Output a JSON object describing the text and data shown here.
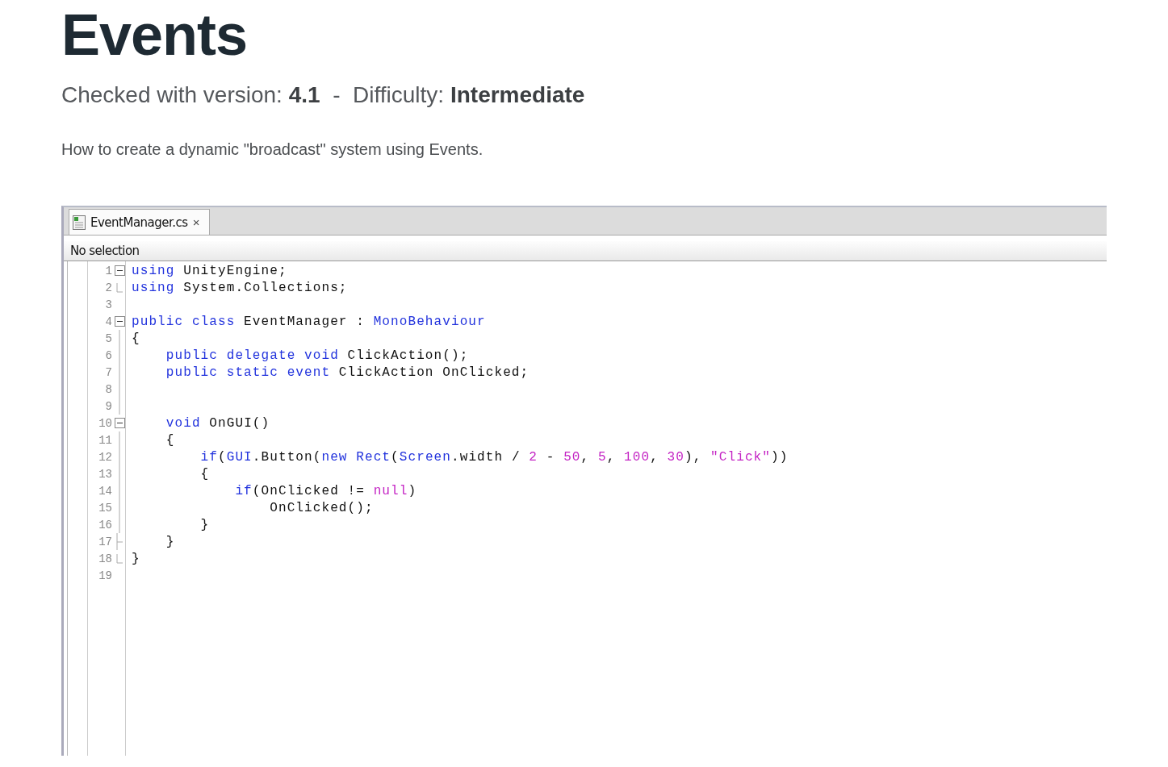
{
  "title": "Events",
  "meta": "Checked with version: **4.1**  -  Difficulty: **Intermediate**",
  "description": "How to create a dynamic \"broadcast\" system using Events.",
  "editor": {
    "tab": {
      "label": "EventManager.cs",
      "close": "×",
      "selected": true
    },
    "status": "No selection",
    "lines": [
      {
        "number": "1",
        "kind": "fold-start",
        "tokens": [
          {
            "text": "using",
            "kind": "kw"
          },
          {
            "text": " UnityEngine;",
            "kind": "plain"
          }
        ]
      },
      {
        "number": "2",
        "kind": "fold-end",
        "tokens": [
          {
            "text": "using",
            "kind": "kw"
          },
          {
            "text": " System.Collections;",
            "kind": "plain"
          }
        ]
      },
      {
        "number": "3",
        "kind": "plain"
      },
      {
        "number": "4",
        "kind": "fold-start",
        "tokens": [
          {
            "text": "public class",
            "kind": "kw"
          },
          {
            "text": " EventManager : ",
            "kind": "plain"
          },
          {
            "text": "MonoBehaviour",
            "kind": "kw"
          }
        ]
      },
      {
        "number": "5",
        "kind": "fold-line",
        "tokens": [
          {
            "text": "{",
            "kind": "plain"
          }
        ]
      },
      {
        "number": "6",
        "kind": "fold-line",
        "tokens": [
          {
            "text": "    public delegate void",
            "kind": "kw"
          },
          {
            "text": " ClickAction();",
            "kind": "plain"
          }
        ]
      },
      {
        "number": "7",
        "kind": "fold-line",
        "tokens": [
          {
            "text": "    public static event",
            "kind": "kw"
          },
          {
            "text": " ClickAction OnClicked;",
            "kind": "plain"
          }
        ]
      },
      {
        "number": "8",
        "kind": "fold-line"
      },
      {
        "number": "9",
        "kind": "fold-line"
      },
      {
        "number": "10",
        "kind": "fold-start",
        "tokens": [
          {
            "text": "    void",
            "kind": "kw"
          },
          {
            "text": " OnGUI()",
            "kind": "plain"
          }
        ]
      },
      {
        "number": "11",
        "kind": "fold-line",
        "tokens": [
          {
            "text": "    {",
            "kind": "plain"
          }
        ]
      },
      {
        "number": "12",
        "kind": "fold-line",
        "tokens": [
          {
            "text": "        if",
            "kind": "kw"
          },
          {
            "text": "(",
            "kind": "plain"
          },
          {
            "text": "GUI",
            "kind": "kw"
          },
          {
            "text": ".Button(",
            "kind": "plain"
          },
          {
            "text": "new Rect",
            "kind": "kw"
          },
          {
            "text": "(",
            "kind": "plain"
          },
          {
            "text": "Screen",
            "kind": "kw"
          },
          {
            "text": ".width / ",
            "kind": "plain"
          },
          {
            "text": "2",
            "kind": "lit"
          },
          {
            "text": " - ",
            "kind": "plain"
          },
          {
            "text": "50",
            "kind": "lit"
          },
          {
            "text": ", ",
            "kind": "plain"
          },
          {
            "text": "5",
            "kind": "lit"
          },
          {
            "text": ", ",
            "kind": "plain"
          },
          {
            "text": "100",
            "kind": "lit"
          },
          {
            "text": ", ",
            "kind": "plain"
          },
          {
            "text": "30",
            "kind": "lit"
          },
          {
            "text": "), ",
            "kind": "plain"
          },
          {
            "text": "\"Click\"",
            "kind": "lit"
          },
          {
            "text": "))",
            "kind": "plain"
          }
        ]
      },
      {
        "number": "13",
        "kind": "fold-line",
        "tokens": [
          {
            "text": "        {",
            "kind": "plain"
          }
        ]
      },
      {
        "number": "14",
        "kind": "fold-line",
        "tokens": [
          {
            "text": "            if",
            "kind": "kw"
          },
          {
            "text": "(OnClicked != ",
            "kind": "plain"
          },
          {
            "text": "null",
            "kind": "lit"
          },
          {
            "text": ")",
            "kind": "plain"
          }
        ]
      },
      {
        "number": "15",
        "kind": "fold-line",
        "tokens": [
          {
            "text": "                OnClicked();",
            "kind": "plain"
          }
        ]
      },
      {
        "number": "16",
        "kind": "fold-line",
        "tokens": [
          {
            "text": "        }",
            "kind": "plain"
          }
        ]
      },
      {
        "number": "17",
        "kind": "fold-branch",
        "tokens": [
          {
            "text": "    }",
            "kind": "plain"
          }
        ]
      },
      {
        "number": "18",
        "kind": "fold-end",
        "tokens": [
          {
            "text": "}",
            "kind": "plain"
          }
        ]
      },
      {
        "number": "19",
        "kind": "plain"
      }
    ]
  }
}
